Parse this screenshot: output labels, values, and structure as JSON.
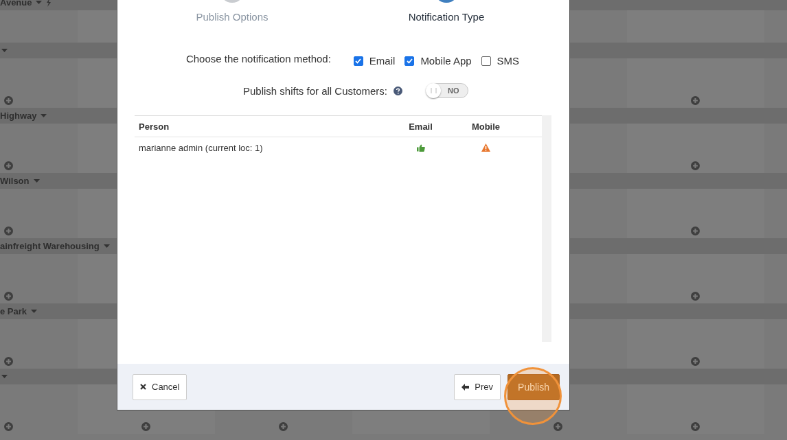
{
  "schedule": {
    "groups": [
      {
        "label": "Avenue",
        "flash": true
      },
      {
        "flash": false
      },
      {
        "label": "Highway",
        "flash": false
      },
      {
        "label": "Wilson",
        "flash": false
      },
      {
        "label": "ainfreight Warehousing",
        "flash": false
      },
      {
        "label": "e Park",
        "flash": false
      },
      {
        "flash": false
      }
    ]
  },
  "dialog": {
    "steps": [
      {
        "label": "Publish Options",
        "selected": false
      },
      {
        "label": "Notification Type",
        "selected": true
      }
    ],
    "method": {
      "label": "Choose the notification method:",
      "options": [
        {
          "label": "Email",
          "checked": true
        },
        {
          "label": "Mobile App",
          "checked": true
        },
        {
          "label": "SMS",
          "checked": false
        }
      ]
    },
    "publish_all": {
      "label": "Publish shifts for all Customers:",
      "on": false,
      "state_text": "NO"
    },
    "table": {
      "columns": [
        "Person",
        "Email",
        "Mobile"
      ],
      "rows": [
        {
          "person": "marianne admin (current loc: 1)",
          "email": {
            "kind": "ok"
          },
          "mobile": {
            "kind": "warning"
          }
        }
      ]
    },
    "buttons": [
      {
        "label": "Cancel",
        "kind": "cancel"
      },
      {
        "label": "Prev",
        "kind": "prev"
      },
      {
        "label": "Publish",
        "kind": "primary",
        "disabled": true
      }
    ]
  }
}
